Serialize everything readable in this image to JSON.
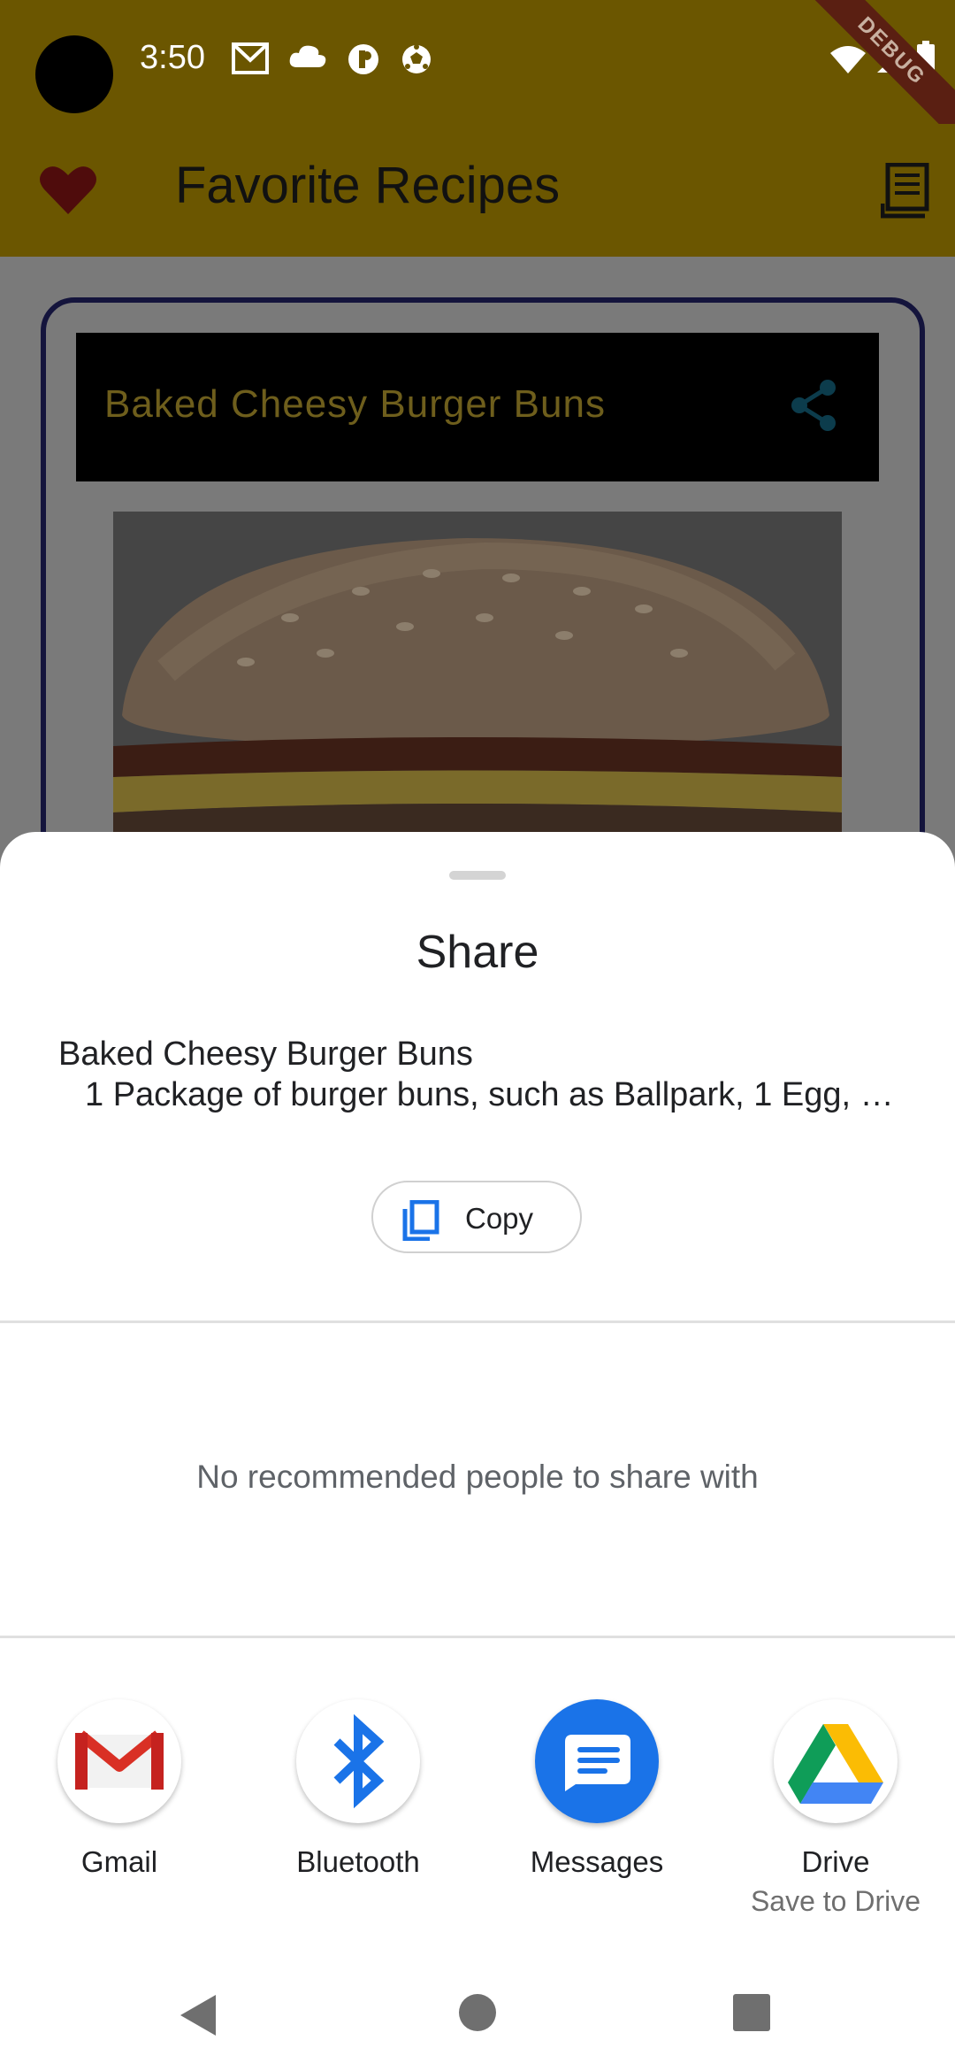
{
  "status_bar": {
    "time": "3:50",
    "debug_label": "DEBUG"
  },
  "app_bar": {
    "title": "Favorite Recipes"
  },
  "recipe_card": {
    "title": "Baked Cheesy Burger Buns"
  },
  "share_sheet": {
    "title": "Share",
    "preview_title": "Baked Cheesy Burger Buns",
    "preview_text": "1 Package of burger buns, such as Ballpark, 1 Egg, …",
    "copy_label": "Copy",
    "no_people_text": "No recommended people to share with",
    "targets": [
      {
        "label": "Gmail",
        "sublabel": ""
      },
      {
        "label": "Bluetooth",
        "sublabel": ""
      },
      {
        "label": "Messages",
        "sublabel": ""
      },
      {
        "label": "Drive",
        "sublabel": "Save to Drive"
      }
    ]
  },
  "colors": {
    "app_bar": "#6b5600",
    "scrim": "#7a7a7a",
    "accent_blue": "#1a73e8",
    "gmail_red": "#d93025"
  },
  "icons": {
    "status": [
      "gmail-icon",
      "cloud-icon",
      "podcast-icon",
      "soccer-icon",
      "wifi-icon",
      "signal-icon",
      "battery-icon"
    ],
    "app_bar": [
      "heart-icon",
      "recipe-book-icon"
    ],
    "nav": [
      "back-icon",
      "home-icon",
      "recents-icon"
    ]
  }
}
